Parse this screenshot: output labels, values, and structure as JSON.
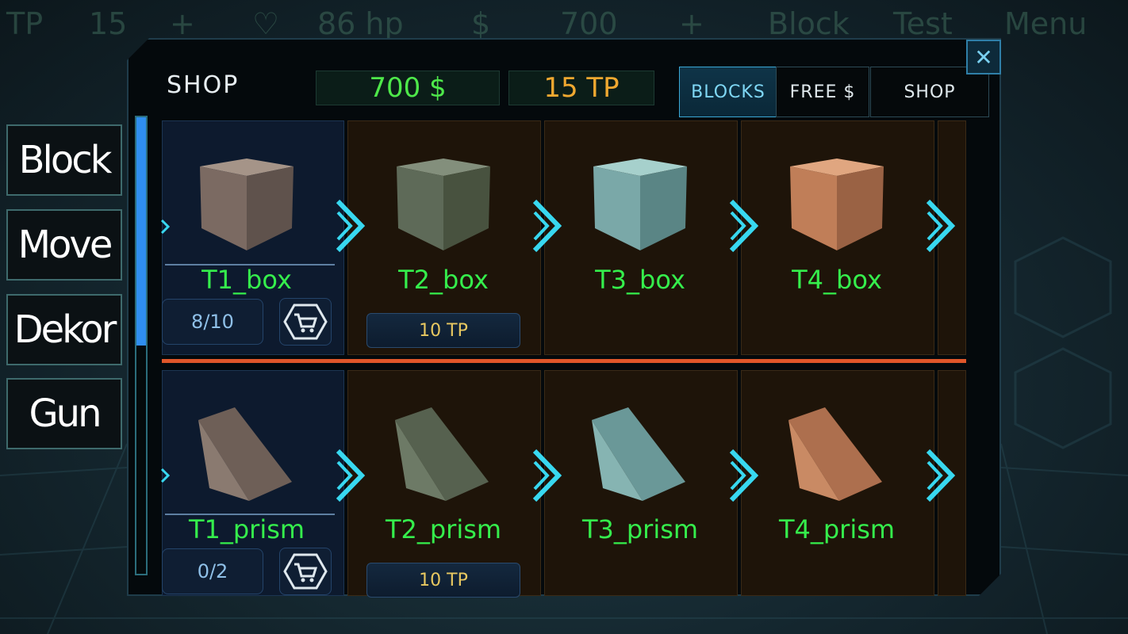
{
  "background_hud": {
    "items": [
      "TP",
      "15",
      "+",
      "86 hp",
      "$",
      "700",
      "+",
      "Block",
      "Test",
      "Menu"
    ]
  },
  "categories": [
    {
      "label": "Block"
    },
    {
      "label": "Move"
    },
    {
      "label": "Dekor"
    },
    {
      "label": "Gun"
    }
  ],
  "shop": {
    "title": "SHOP",
    "money": "700 $",
    "tp": "15 TP",
    "money_color": "#4ee84a",
    "tp_color": "#f0a830",
    "close_label": "✕",
    "tabs": [
      {
        "label": "BLOCKS",
        "active": true
      },
      {
        "label": "FREE $",
        "active": false
      },
      {
        "label": "SHOP",
        "active": false
      }
    ]
  },
  "rows": [
    {
      "items": [
        {
          "name": "T1_box",
          "count": "8/10",
          "color": "#7b6a62"
        },
        {
          "name": "T2_box",
          "price": "10 TP",
          "color": "#5e6a58"
        },
        {
          "name": "T3_box",
          "color": "#7aa8a8"
        },
        {
          "name": "T4_box",
          "color": "#c07e58"
        }
      ]
    },
    {
      "items": [
        {
          "name": "T1_prism",
          "count": "0/2",
          "color": "#7b6a62"
        },
        {
          "name": "T2_prism",
          "price": "10 TP",
          "color": "#5e6a58"
        },
        {
          "name": "T3_prism",
          "color": "#7aa8a8"
        },
        {
          "name": "T4_prism",
          "color": "#c07e58"
        }
      ]
    }
  ],
  "icons": {
    "cart": "shopping-cart-icon",
    "arrow": "double-chevron-right-icon",
    "close": "close-icon"
  }
}
